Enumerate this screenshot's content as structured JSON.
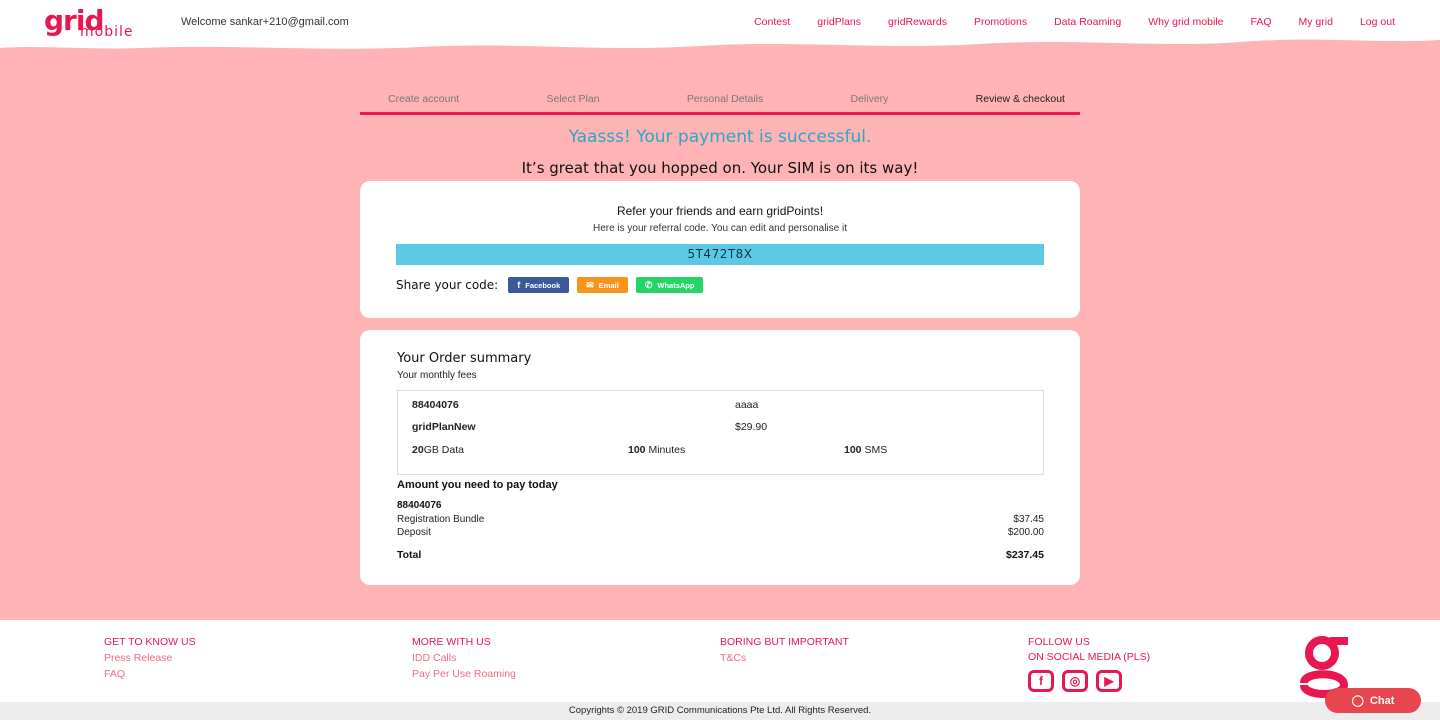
{
  "header": {
    "logo_top": "grid",
    "logo_bottom": "mobile",
    "welcome": "Welcome sankar+210@gmail.com",
    "nav": [
      "Contest",
      "gridPlans",
      "gridRewards",
      "Promotions",
      "Data Roaming",
      "Why grid mobile",
      "FAQ",
      "My grid",
      "Log out"
    ]
  },
  "colors": {
    "brand": "#e8174f",
    "page_bg": "#ffb3b5",
    "code_bg": "#5bc8e5",
    "success_text": "#2aa6c8"
  },
  "steps": [
    "Create account",
    "Select Plan",
    "Personal Details",
    "Delivery",
    "Review & checkout"
  ],
  "active_step": "Review & checkout",
  "success": {
    "title": "Yaasss! Your payment is successful.",
    "subtitle": "It’s great that you hopped on. Your SIM is on its way!"
  },
  "referral": {
    "title": "Refer your friends and earn gridPoints!",
    "hint": "Here is your referral code. You can edit and personalise it",
    "code": "5T472T8X",
    "share_label": "Share your code:",
    "buttons": {
      "facebook": "Facebook",
      "email": "Email",
      "whatsapp": "WhatsApp"
    }
  },
  "order": {
    "title": "Your Order summary",
    "subtitle": "Your monthly fees",
    "number": "88404076",
    "name_value": "aaaa",
    "plan": "gridPlanNew",
    "price": "$29.90",
    "data_amount": "20",
    "data_unit": "GB Data",
    "minutes_amount": "100",
    "minutes_unit": " Minutes",
    "sms_amount": "100",
    "sms_unit": " SMS",
    "pay_title": "Amount you need to pay today",
    "pay_number": "88404076",
    "items": [
      {
        "label": "Registration Bundle",
        "amount": "$37.45"
      },
      {
        "label": "Deposit",
        "amount": "$200.00"
      }
    ],
    "total_label": "Total",
    "total_amount": "$237.45"
  },
  "footer": {
    "col1": {
      "heading": "GET TO KNOW US",
      "links": [
        "Press Release",
        "FAQ"
      ]
    },
    "col2": {
      "heading": "MORE WITH US",
      "links": [
        "IDD Calls",
        "Pay Per Use Roaming"
      ]
    },
    "col3": {
      "heading": "BORING BUT IMPORTANT",
      "links": [
        "T&Cs"
      ]
    },
    "col4": {
      "heading1": "FOLLOW US",
      "heading2": "ON SOCIAL MEDIA (PLS)"
    },
    "social_icons": [
      "facebook-icon",
      "instagram-icon",
      "youtube-icon"
    ],
    "copyright": "Copyrights © 2019 GRID Communications Pte Ltd. All Rights Reserved."
  },
  "chat": {
    "label": "Chat"
  }
}
